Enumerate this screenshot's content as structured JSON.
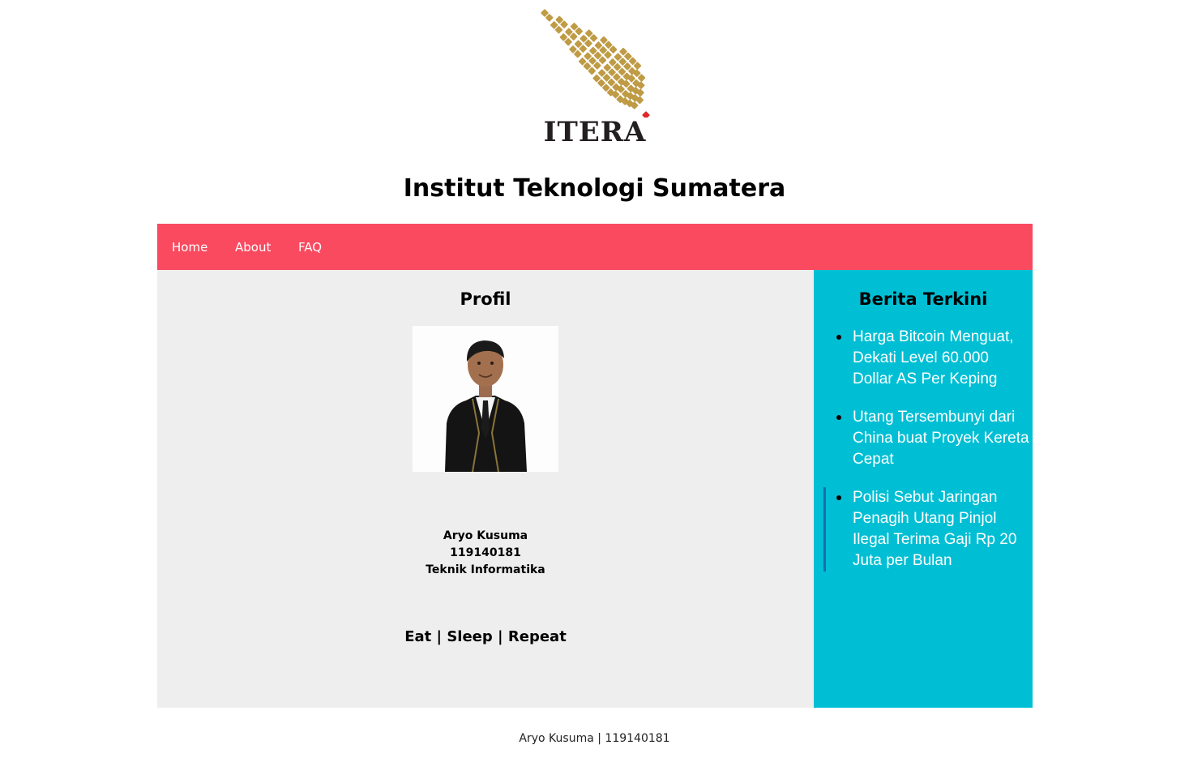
{
  "header": {
    "logo_text": "ITERA",
    "logo_icon": "sumatra-island-logo-icon",
    "site_title": "Institut Teknologi Sumatera"
  },
  "nav": {
    "items": [
      {
        "label": "Home"
      },
      {
        "label": "About"
      },
      {
        "label": "FAQ"
      }
    ]
  },
  "profile": {
    "title": "Profil",
    "name": "Aryo Kusuma",
    "nim": "119140181",
    "major": "Teknik Informatika",
    "motto": "Eat | Sleep | Repeat"
  },
  "news": {
    "title": "Berita Terkini",
    "items": [
      {
        "text": "Harga Bitcoin Menguat, Dekati Level 60.000 Dollar AS Per Keping"
      },
      {
        "text": "Utang Tersembunyi dari China buat Proyek Kereta Cepat"
      },
      {
        "text": "Polisi Sebut Jaringan Penagih Utang Pinjol Ilegal Terima Gaji Rp 20 Juta per Bulan"
      }
    ]
  },
  "footer": {
    "text": "Aryo Kusuma | 119140181"
  },
  "colors": {
    "navbar": "#f94a60",
    "sidebar": "#00bfd4",
    "main_bg": "#eeeeee",
    "logo_gold": "#bf9b45",
    "logo_red": "#e0282a"
  }
}
